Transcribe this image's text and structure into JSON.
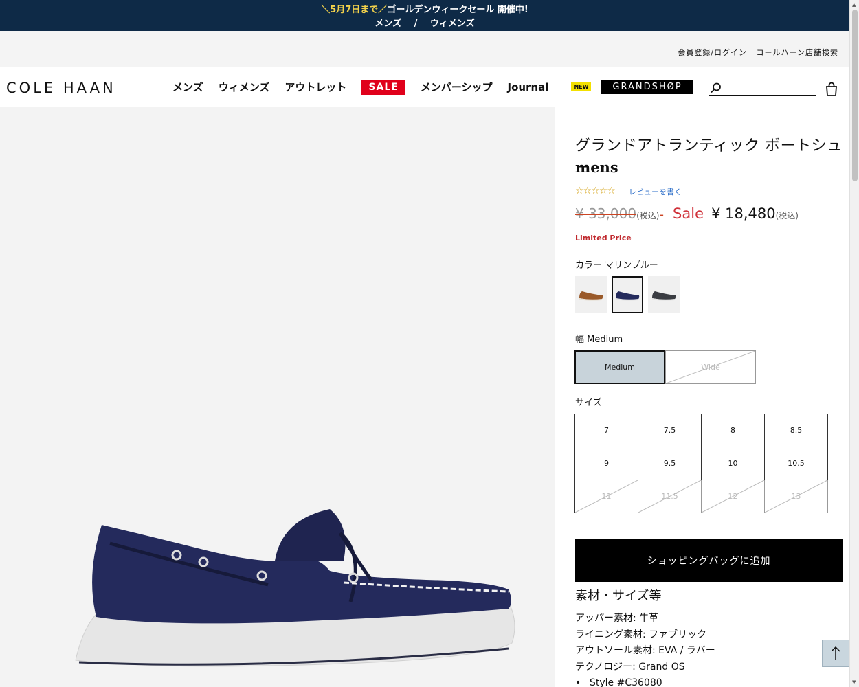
{
  "promo": {
    "highlight": "＼5月7日まで／",
    "text": "ゴールデンウィークセール 開催中!",
    "link_mens": "メンズ",
    "separator": "/",
    "link_womens": "ウィメンズ"
  },
  "utility": {
    "register_login": "会員登録/ログイン",
    "store_search": "コールハーン店舗検索"
  },
  "header": {
    "logo": "COLE HAAN",
    "nav": {
      "mens": "メンズ",
      "womens": "ウィメンズ",
      "outlet": "アウトレット",
      "sale": "SALE",
      "membership": "メンバーシップ",
      "journal": "Journal",
      "new_badge": "NEW",
      "grandshop": "GRANDSHØP"
    },
    "search_placeholder": ""
  },
  "product": {
    "title": "グランドアトランティック ボートシュー",
    "gender": "mens",
    "rating_stars": "☆☆☆☆☆",
    "review_link": "レビューを書く",
    "old_price": "¥ 33,000",
    "tax_label": "(税込)",
    "dash": "-",
    "sale_label": "Sale",
    "sale_price": "¥ 18,480",
    "limited_label": "Limited Price",
    "color_label": "カラー マリンブルー",
    "colors": [
      "brown",
      "marine-blue",
      "dark-gray"
    ],
    "width_label": "幅 Medium",
    "widths": [
      {
        "label": "Medium",
        "selected": true,
        "available": true
      },
      {
        "label": "Wide",
        "selected": false,
        "available": false
      }
    ],
    "size_label": "サイズ",
    "sizes": [
      {
        "label": "7",
        "available": true
      },
      {
        "label": "7.5",
        "available": true
      },
      {
        "label": "8",
        "available": true
      },
      {
        "label": "8.5",
        "available": true
      },
      {
        "label": "9",
        "available": true
      },
      {
        "label": "9.5",
        "available": true
      },
      {
        "label": "10",
        "available": true
      },
      {
        "label": "10.5",
        "available": true
      },
      {
        "label": "11",
        "available": false
      },
      {
        "label": "11.5",
        "available": false
      },
      {
        "label": "12",
        "available": false
      },
      {
        "label": "13",
        "available": false
      }
    ],
    "add_to_bag": "ショッピングバッグに追加",
    "spec_title": "素材・サイズ等",
    "specs": [
      "アッパー素材: 牛革",
      "ライニング素材: ファブリック",
      "アウトソール素材: EVA / ラバー",
      "テクノロジー: Grand OS"
    ],
    "style_number": "Style #C36080"
  },
  "colors": {
    "promo_bg": "#0e2a47",
    "promo_highlight": "#f3d24b",
    "sale_red": "#d0323a",
    "selected_width_bg": "#c8d3da"
  }
}
